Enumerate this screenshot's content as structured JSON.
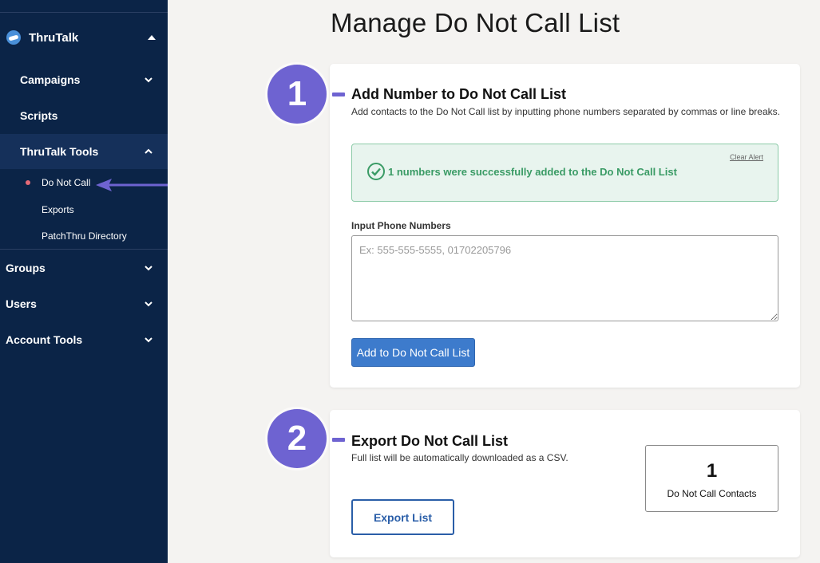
{
  "sidebar": {
    "brand": "ThruTalk",
    "campaigns": "Campaigns",
    "scripts": "Scripts",
    "tools": "ThruTalk Tools",
    "tools_children": [
      "Do Not Call",
      "Exports",
      "PatchThru Directory"
    ],
    "groups": "Groups",
    "users": "Users",
    "account_tools": "Account Tools",
    "active_dot_color": "#e46a77",
    "bg_color": "#0b2447"
  },
  "page": {
    "title": "Manage Do Not Call List"
  },
  "section1": {
    "badge": "1",
    "title": "Add Number to Do Not Call List",
    "description": "Add contacts to the Do Not Call list by inputting phone numbers separated by commas or line breaks.",
    "alert_text": "1 numbers were successfully added to the Do Not Call List",
    "clear_alert": "Clear Alert",
    "input_label": "Input Phone Numbers",
    "input_placeholder": "Ex: 555-555-5555, 01702205796",
    "input_value": "",
    "submit_label": "Add to Do Not Call List"
  },
  "section2": {
    "badge": "2",
    "title": "Export Do Not Call List",
    "description": "Full list will be automatically downloaded as a CSV.",
    "export_label": "Export List",
    "count": "1",
    "count_label": "Do Not Call Contacts"
  },
  "colors": {
    "badge": "#6e63d1",
    "primary_button": "#3d7bcc",
    "success_text": "#3a9b65",
    "success_bg": "#e8f4ee"
  }
}
